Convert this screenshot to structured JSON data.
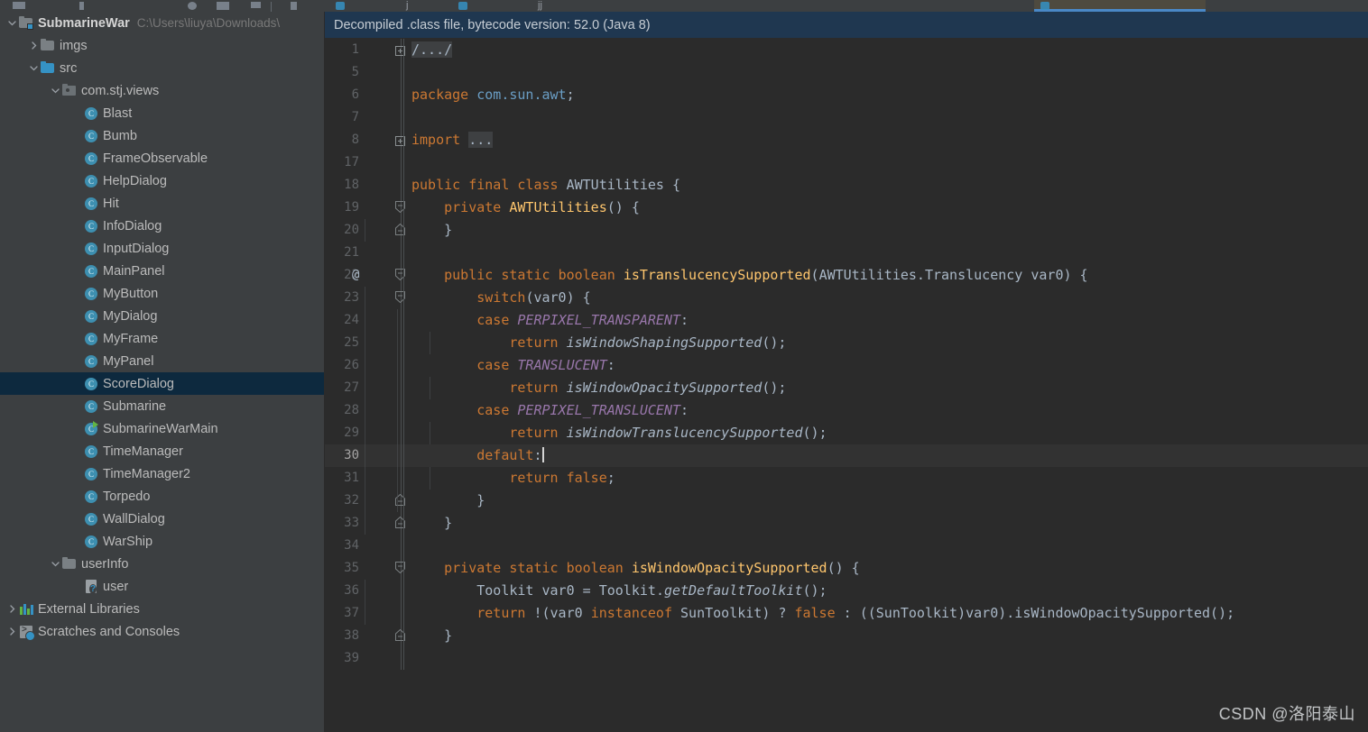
{
  "window": {
    "theme_name": "darcula",
    "colors": {
      "sidebar_bg": "#3c3f41",
      "editor_bg": "#2b2b2b",
      "notice_bg": "#1f3750",
      "selection_bg": "#0d293e",
      "accent": "#3592c4",
      "keyword": "#cc7832",
      "method": "#ffc66d",
      "constant": "#9876aa",
      "caret_row": "#323232",
      "line_number": "#606366"
    }
  },
  "sidebar": {
    "name": "Project tool window",
    "items": [
      {
        "label": "SubmarineWar",
        "path": "C:\\Users\\liuya\\Downloads\\",
        "icon": "project-root-icon",
        "indent": 0,
        "arrow": "down",
        "kind": "project",
        "selected": false,
        "bold": true
      },
      {
        "label": "imgs",
        "path": "",
        "icon": "folder-icon",
        "indent": 1,
        "arrow": "right",
        "kind": "folder-grey",
        "selected": false,
        "bold": false
      },
      {
        "label": "src",
        "path": "",
        "icon": "folder-icon",
        "indent": 1,
        "arrow": "down",
        "kind": "folder-blue",
        "selected": false,
        "bold": false
      },
      {
        "label": "com.stj.views",
        "path": "",
        "icon": "package-icon",
        "indent": 2,
        "arrow": "down",
        "kind": "package",
        "selected": false,
        "bold": false
      },
      {
        "label": "Blast",
        "path": "",
        "icon": "java-class-icon",
        "indent": 3,
        "arrow": "none",
        "kind": "class",
        "selected": false,
        "bold": false
      },
      {
        "label": "Bumb",
        "path": "",
        "icon": "java-class-icon",
        "indent": 3,
        "arrow": "none",
        "kind": "class",
        "selected": false,
        "bold": false
      },
      {
        "label": "FrameObservable",
        "path": "",
        "icon": "java-class-icon",
        "indent": 3,
        "arrow": "none",
        "kind": "class",
        "selected": false,
        "bold": false
      },
      {
        "label": "HelpDialog",
        "path": "",
        "icon": "java-class-icon",
        "indent": 3,
        "arrow": "none",
        "kind": "class",
        "selected": false,
        "bold": false
      },
      {
        "label": "Hit",
        "path": "",
        "icon": "java-class-icon",
        "indent": 3,
        "arrow": "none",
        "kind": "class",
        "selected": false,
        "bold": false
      },
      {
        "label": "InfoDialog",
        "path": "",
        "icon": "java-class-icon",
        "indent": 3,
        "arrow": "none",
        "kind": "class",
        "selected": false,
        "bold": false
      },
      {
        "label": "InputDialog",
        "path": "",
        "icon": "java-class-icon",
        "indent": 3,
        "arrow": "none",
        "kind": "class",
        "selected": false,
        "bold": false
      },
      {
        "label": "MainPanel",
        "path": "",
        "icon": "java-class-icon",
        "indent": 3,
        "arrow": "none",
        "kind": "class",
        "selected": false,
        "bold": false
      },
      {
        "label": "MyButton",
        "path": "",
        "icon": "java-class-icon",
        "indent": 3,
        "arrow": "none",
        "kind": "class",
        "selected": false,
        "bold": false
      },
      {
        "label": "MyDialog",
        "path": "",
        "icon": "java-class-icon",
        "indent": 3,
        "arrow": "none",
        "kind": "class",
        "selected": false,
        "bold": false
      },
      {
        "label": "MyFrame",
        "path": "",
        "icon": "java-class-icon",
        "indent": 3,
        "arrow": "none",
        "kind": "class",
        "selected": false,
        "bold": false
      },
      {
        "label": "MyPanel",
        "path": "",
        "icon": "java-class-icon",
        "indent": 3,
        "arrow": "none",
        "kind": "class",
        "selected": false,
        "bold": false
      },
      {
        "label": "ScoreDialog",
        "path": "",
        "icon": "java-class-icon",
        "indent": 3,
        "arrow": "none",
        "kind": "class",
        "selected": true,
        "bold": false
      },
      {
        "label": "Submarine",
        "path": "",
        "icon": "java-class-icon",
        "indent": 3,
        "arrow": "none",
        "kind": "class",
        "selected": false,
        "bold": false
      },
      {
        "label": "SubmarineWarMain",
        "path": "",
        "icon": "java-runnable-class-icon",
        "indent": 3,
        "arrow": "none",
        "kind": "class-run",
        "selected": false,
        "bold": false
      },
      {
        "label": "TimeManager",
        "path": "",
        "icon": "java-class-icon",
        "indent": 3,
        "arrow": "none",
        "kind": "class",
        "selected": false,
        "bold": false
      },
      {
        "label": "TimeManager2",
        "path": "",
        "icon": "java-class-icon",
        "indent": 3,
        "arrow": "none",
        "kind": "class",
        "selected": false,
        "bold": false
      },
      {
        "label": "Torpedo",
        "path": "",
        "icon": "java-class-icon",
        "indent": 3,
        "arrow": "none",
        "kind": "class",
        "selected": false,
        "bold": false
      },
      {
        "label": "WallDialog",
        "path": "",
        "icon": "java-class-icon",
        "indent": 3,
        "arrow": "none",
        "kind": "class",
        "selected": false,
        "bold": false
      },
      {
        "label": "WarShip",
        "path": "",
        "icon": "java-class-icon",
        "indent": 3,
        "arrow": "none",
        "kind": "class",
        "selected": false,
        "bold": false
      },
      {
        "label": "userInfo",
        "path": "",
        "icon": "folder-icon",
        "indent": 2,
        "arrow": "down",
        "kind": "folder-grey",
        "selected": false,
        "bold": false
      },
      {
        "label": "user",
        "path": "",
        "icon": "unknown-file-icon",
        "indent": 3,
        "arrow": "none",
        "kind": "qfile",
        "selected": false,
        "bold": false
      },
      {
        "label": "External Libraries",
        "path": "",
        "icon": "libraries-icon",
        "indent": 0,
        "arrow": "right",
        "kind": "libraries",
        "selected": false,
        "bold": false
      },
      {
        "label": "Scratches and Consoles",
        "path": "",
        "icon": "scratches-icon",
        "indent": 0,
        "arrow": "right",
        "kind": "scratches",
        "selected": false,
        "bold": false
      }
    ]
  },
  "editor": {
    "notice": "Decompiled .class file, bytecode version: 52.0 (Java 8)",
    "watermark": "CSDN @洛阳泰山",
    "caret_line": 30,
    "lines": [
      {
        "n": "1",
        "fold": "plus",
        "annot": "",
        "indent_guides": 0,
        "tokens": [
          {
            "t": "/.../",
            "c": "fldbox"
          }
        ]
      },
      {
        "n": "5",
        "fold": "none",
        "annot": "",
        "indent_guides": 0,
        "tokens": []
      },
      {
        "n": "6",
        "fold": "none",
        "annot": "",
        "indent_guides": 0,
        "tokens": [
          {
            "t": "package",
            "c": "kw"
          },
          {
            "t": " ",
            "c": ""
          },
          {
            "t": "com.sun.awt",
            "c": "pkgname"
          },
          {
            "t": ";",
            "c": ""
          }
        ]
      },
      {
        "n": "7",
        "fold": "none",
        "annot": "",
        "indent_guides": 0,
        "tokens": []
      },
      {
        "n": "8",
        "fold": "plus",
        "annot": "",
        "indent_guides": 0,
        "tokens": [
          {
            "t": "import",
            "c": "kw"
          },
          {
            "t": " ",
            "c": ""
          },
          {
            "t": "...",
            "c": "fldbox"
          }
        ]
      },
      {
        "n": "17",
        "fold": "none",
        "annot": "",
        "indent_guides": 0,
        "tokens": []
      },
      {
        "n": "18",
        "fold": "none",
        "annot": "",
        "indent_guides": 0,
        "tokens": [
          {
            "t": "public",
            "c": "kw"
          },
          {
            "t": " ",
            "c": ""
          },
          {
            "t": "final",
            "c": "kw"
          },
          {
            "t": " ",
            "c": ""
          },
          {
            "t": "class",
            "c": "kw"
          },
          {
            "t": " ",
            "c": ""
          },
          {
            "t": "AWTUtilities",
            "c": "type"
          },
          {
            "t": " {",
            "c": ""
          }
        ]
      },
      {
        "n": "19",
        "fold": "down",
        "annot": "",
        "indent_guides": 0,
        "tokens": [
          {
            "t": "    ",
            "c": ""
          },
          {
            "t": "private",
            "c": "kw"
          },
          {
            "t": " ",
            "c": ""
          },
          {
            "t": "AWTUtilities",
            "c": "mname"
          },
          {
            "t": "() {",
            "c": ""
          }
        ]
      },
      {
        "n": "20",
        "fold": "up",
        "annot": "",
        "indent_guides": 1,
        "tokens": [
          {
            "t": "    }",
            "c": ""
          }
        ]
      },
      {
        "n": "21",
        "fold": "none",
        "annot": "",
        "indent_guides": 0,
        "tokens": []
      },
      {
        "n": "22",
        "fold": "down",
        "annot": "@",
        "indent_guides": 0,
        "tokens": [
          {
            "t": "    ",
            "c": ""
          },
          {
            "t": "public",
            "c": "kw"
          },
          {
            "t": " ",
            "c": ""
          },
          {
            "t": "static",
            "c": "kw"
          },
          {
            "t": " ",
            "c": ""
          },
          {
            "t": "boolean",
            "c": "kw"
          },
          {
            "t": " ",
            "c": ""
          },
          {
            "t": "isTranslucencySupported",
            "c": "mname"
          },
          {
            "t": "(",
            "c": ""
          },
          {
            "t": "AWTUtilities.Translucency",
            "c": "type"
          },
          {
            "t": " var0) {",
            "c": ""
          }
        ]
      },
      {
        "n": "23",
        "fold": "down",
        "annot": "",
        "indent_guides": 1,
        "tokens": [
          {
            "t": "        ",
            "c": ""
          },
          {
            "t": "switch",
            "c": "kw"
          },
          {
            "t": "(var0) {",
            "c": ""
          }
        ]
      },
      {
        "n": "24",
        "fold": "none",
        "annot": "",
        "indent_guides": 2,
        "tokens": [
          {
            "t": "        ",
            "c": ""
          },
          {
            "t": "case",
            "c": "kw"
          },
          {
            "t": " ",
            "c": ""
          },
          {
            "t": "PERPIXEL_TRANSPARENT",
            "c": "konst"
          },
          {
            "t": ":",
            "c": ""
          }
        ]
      },
      {
        "n": "25",
        "fold": "none",
        "annot": "",
        "indent_guides": 3,
        "tokens": [
          {
            "t": "            ",
            "c": ""
          },
          {
            "t": "return",
            "c": "kw"
          },
          {
            "t": " ",
            "c": ""
          },
          {
            "t": "isWindowShapingSupported",
            "c": "calli"
          },
          {
            "t": "();",
            "c": ""
          }
        ]
      },
      {
        "n": "26",
        "fold": "none",
        "annot": "",
        "indent_guides": 2,
        "tokens": [
          {
            "t": "        ",
            "c": ""
          },
          {
            "t": "case",
            "c": "kw"
          },
          {
            "t": " ",
            "c": ""
          },
          {
            "t": "TRANSLUCENT",
            "c": "konst"
          },
          {
            "t": ":",
            "c": ""
          }
        ]
      },
      {
        "n": "27",
        "fold": "none",
        "annot": "",
        "indent_guides": 3,
        "tokens": [
          {
            "t": "            ",
            "c": ""
          },
          {
            "t": "return",
            "c": "kw"
          },
          {
            "t": " ",
            "c": ""
          },
          {
            "t": "isWindowOpacitySupported",
            "c": "calli"
          },
          {
            "t": "();",
            "c": ""
          }
        ]
      },
      {
        "n": "28",
        "fold": "none",
        "annot": "",
        "indent_guides": 2,
        "tokens": [
          {
            "t": "        ",
            "c": ""
          },
          {
            "t": "case",
            "c": "kw"
          },
          {
            "t": " ",
            "c": ""
          },
          {
            "t": "PERPIXEL_TRANSLUCENT",
            "c": "konst"
          },
          {
            "t": ":",
            "c": ""
          }
        ]
      },
      {
        "n": "29",
        "fold": "none",
        "annot": "",
        "indent_guides": 3,
        "tokens": [
          {
            "t": "            ",
            "c": ""
          },
          {
            "t": "return",
            "c": "kw"
          },
          {
            "t": " ",
            "c": ""
          },
          {
            "t": "isWindowTranslucencySupported",
            "c": "calli"
          },
          {
            "t": "();",
            "c": ""
          }
        ]
      },
      {
        "n": "30",
        "fold": "none",
        "annot": "",
        "indent_guides": 2,
        "caret": true,
        "tokens": [
          {
            "t": "        ",
            "c": ""
          },
          {
            "t": "default",
            "c": "kw"
          },
          {
            "t": ":",
            "c": ""
          },
          {
            "t": "|CARET|",
            "c": "caret"
          }
        ]
      },
      {
        "n": "31",
        "fold": "none",
        "annot": "",
        "indent_guides": 3,
        "tokens": [
          {
            "t": "            ",
            "c": ""
          },
          {
            "t": "return",
            "c": "kw"
          },
          {
            "t": " ",
            "c": ""
          },
          {
            "t": "false",
            "c": "kw"
          },
          {
            "t": ";",
            "c": ""
          }
        ]
      },
      {
        "n": "32",
        "fold": "up",
        "annot": "",
        "indent_guides": 2,
        "tokens": [
          {
            "t": "        }",
            "c": ""
          }
        ]
      },
      {
        "n": "33",
        "fold": "up",
        "annot": "",
        "indent_guides": 1,
        "tokens": [
          {
            "t": "    }",
            "c": ""
          }
        ]
      },
      {
        "n": "34",
        "fold": "none",
        "annot": "",
        "indent_guides": 0,
        "tokens": []
      },
      {
        "n": "35",
        "fold": "down",
        "annot": "",
        "indent_guides": 0,
        "tokens": [
          {
            "t": "    ",
            "c": ""
          },
          {
            "t": "private",
            "c": "kw"
          },
          {
            "t": " ",
            "c": ""
          },
          {
            "t": "static",
            "c": "kw"
          },
          {
            "t": " ",
            "c": ""
          },
          {
            "t": "boolean",
            "c": "kw"
          },
          {
            "t": " ",
            "c": ""
          },
          {
            "t": "isWindowOpacitySupported",
            "c": "mname"
          },
          {
            "t": "() {",
            "c": ""
          }
        ]
      },
      {
        "n": "36",
        "fold": "none",
        "annot": "",
        "indent_guides": 1,
        "tokens": [
          {
            "t": "        ",
            "c": ""
          },
          {
            "t": "Toolkit",
            "c": "type"
          },
          {
            "t": " var0 = ",
            "c": ""
          },
          {
            "t": "Toolkit",
            "c": "type"
          },
          {
            "t": ".",
            "c": ""
          },
          {
            "t": "getDefaultToolkit",
            "c": "calli"
          },
          {
            "t": "();",
            "c": ""
          }
        ]
      },
      {
        "n": "37",
        "fold": "none",
        "annot": "",
        "indent_guides": 1,
        "tokens": [
          {
            "t": "        ",
            "c": ""
          },
          {
            "t": "return",
            "c": "kw"
          },
          {
            "t": " !(var0 ",
            "c": ""
          },
          {
            "t": "instanceof",
            "c": "kw"
          },
          {
            "t": " ",
            "c": ""
          },
          {
            "t": "SunToolkit",
            "c": "type"
          },
          {
            "t": ") ? ",
            "c": ""
          },
          {
            "t": "false",
            "c": "kw"
          },
          {
            "t": " : ((",
            "c": ""
          },
          {
            "t": "SunToolkit",
            "c": "type"
          },
          {
            "t": ")var0).isWindowOpacitySupported();",
            "c": ""
          }
        ]
      },
      {
        "n": "38",
        "fold": "up",
        "annot": "",
        "indent_guides": 0,
        "tokens": [
          {
            "t": "    }",
            "c": ""
          }
        ]
      },
      {
        "n": "39",
        "fold": "none",
        "annot": "",
        "indent_guides": 0,
        "tokens": []
      }
    ]
  }
}
